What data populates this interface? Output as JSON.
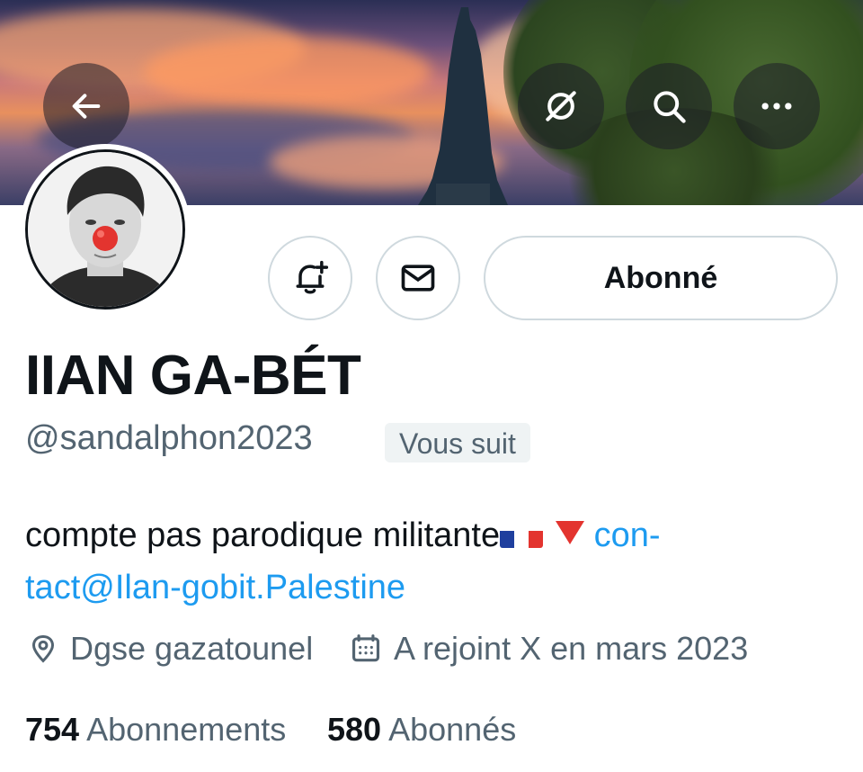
{
  "header": {
    "back_icon": "arrow-left-icon",
    "grok_icon": "grok-icon",
    "search_icon": "search-icon",
    "more_icon": "more-horizontal-icon"
  },
  "profile": {
    "display_name": "IIAN GA-BÉT",
    "handle": "@sandalphon2023",
    "follows_you": "Vous suit",
    "bio_text": "compte pas parodique militante",
    "bio_link_part1": "con-",
    "bio_link_part2": "tact@Ilan-gobit.Palestine",
    "location": "Dgse gazatounel",
    "joined": "A rejoint X en mars 2023",
    "following_count": "754",
    "following_label": "Abonnements",
    "followers_count": "580",
    "followers_label": "Abonnés"
  },
  "actions": {
    "notify_icon": "bell-plus-icon",
    "message_icon": "mail-icon",
    "follow_label": "Abonné"
  },
  "colors": {
    "link": "#1d9bf0",
    "muted": "#536471",
    "text": "#0f1419",
    "border": "#cfd9de"
  }
}
